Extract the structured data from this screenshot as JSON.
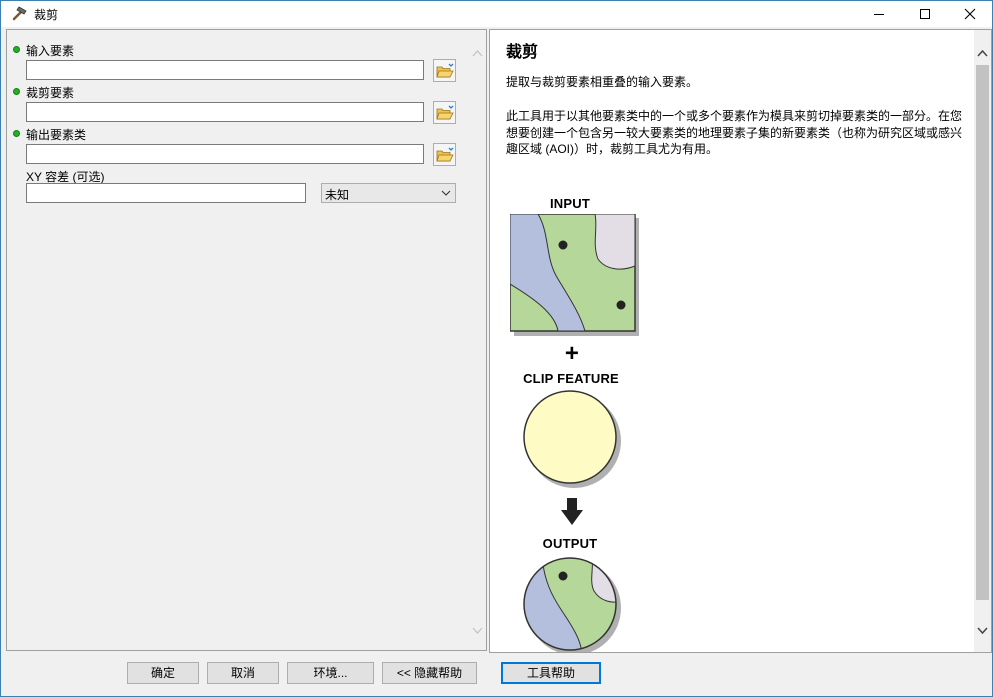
{
  "window": {
    "title": "裁剪",
    "title_icon": "hammer-icon"
  },
  "params": {
    "input_features_label": "输入要素",
    "input_features_value": "",
    "clip_features_label": "裁剪要素",
    "clip_features_value": "",
    "output_class_label": "输出要素类",
    "output_class_value": "",
    "xy_tolerance_label": "XY 容差 (可选)",
    "xy_tolerance_value": "",
    "xy_unit_selected": "未知"
  },
  "help": {
    "title": "裁剪",
    "summary": "提取与裁剪要素相重叠的输入要素。",
    "description": "此工具用于以其他要素类中的一个或多个要素作为模具来剪切掉要素类的一部分。在您想要创建一个包含另一较大要素类的地理要素子集的新要素类（也称为研究区域或感兴趣区域 (AOI)）时，裁剪工具尤为有用。",
    "diagram": {
      "input_label": "INPUT",
      "plus": "+",
      "clip_label": "CLIP FEATURE",
      "output_label": "OUTPUT"
    }
  },
  "buttons": {
    "ok": "确定",
    "cancel": "取消",
    "environments": "环境...",
    "hide_help": "<< 隐藏帮助",
    "tool_help": "工具帮助"
  },
  "colors": {
    "accent": "#0078d7",
    "required_dot": "#23b023",
    "map_green": "#b5d79a",
    "map_blue": "#b3bfdc",
    "map_lavender": "#e3dde6",
    "clip_yellow": "#fffbc4"
  }
}
